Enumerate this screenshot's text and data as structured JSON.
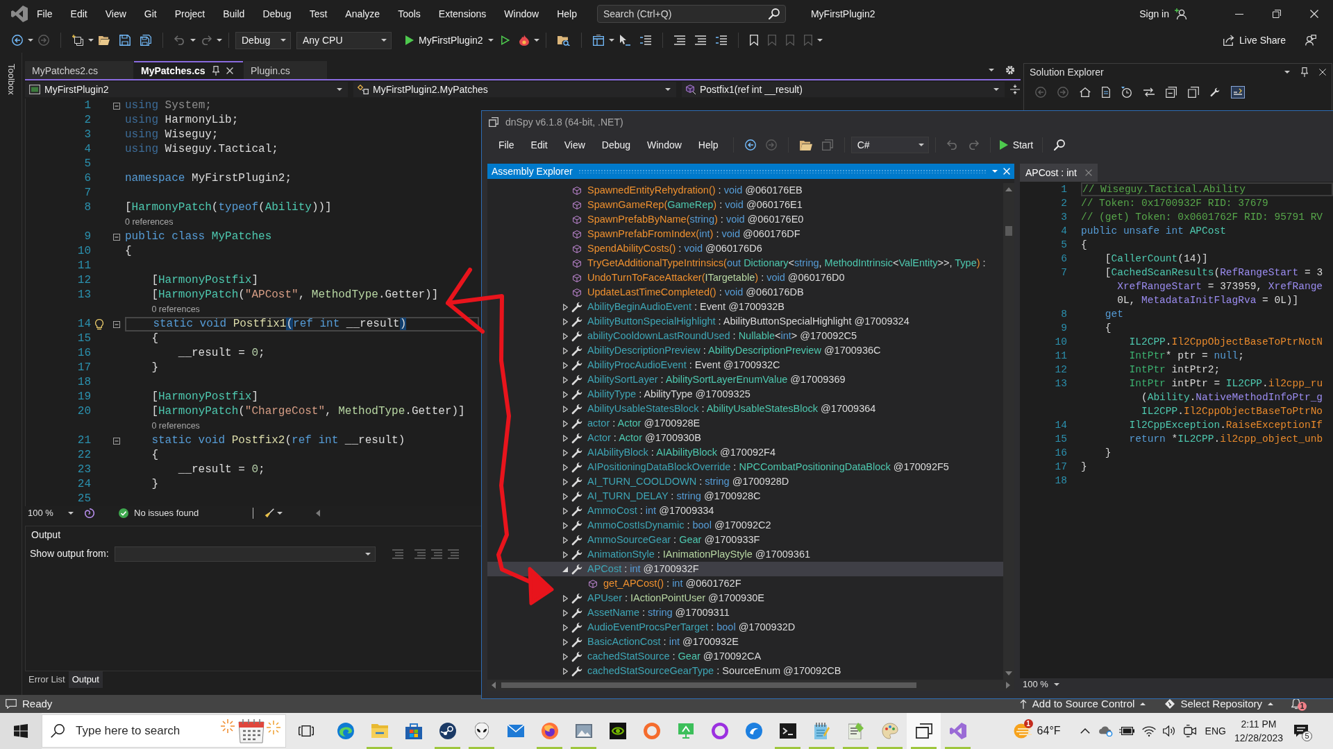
{
  "window": {
    "title": "MyFirstPlugin2",
    "search": {
      "placeholder": "Search (Ctrl+Q)"
    },
    "sign_in": "Sign in"
  },
  "menu": [
    "File",
    "Edit",
    "View",
    "Git",
    "Project",
    "Build",
    "Debug",
    "Test",
    "Analyze",
    "Tools",
    "Extensions",
    "Window",
    "Help"
  ],
  "toolbar": {
    "configuration": "Debug",
    "platform": "Any CPU",
    "start": "MyFirstPlugin2",
    "live_share": "Live Share"
  },
  "toolbox": "Toolbox",
  "tabs": [
    {
      "label": "MyPatches2.cs",
      "selected": false
    },
    {
      "label": "MyPatches.cs",
      "selected": true
    },
    {
      "label": "Plugin.cs",
      "selected": false
    }
  ],
  "navigation": [
    "MyFirstPlugin2",
    "MyFirstPlugin2.MyPatches",
    "Postfix1(ref int __result)"
  ],
  "editor": {
    "zoom": "100 %",
    "issues": "No issues found",
    "lines": [
      {
        "number": "1",
        "current": false,
        "expanded": true,
        "tokens": [
          {
            "text": "using",
            "kind": "dimkw"
          },
          {
            "text": " System;",
            "kind": "dim"
          }
        ]
      },
      {
        "number": "2",
        "current": false,
        "tokens": [
          {
            "text": "using",
            "kind": "dimkw"
          },
          {
            "text": " HarmonyLib;",
            "kind": "plain"
          }
        ]
      },
      {
        "number": "3",
        "current": false,
        "tokens": [
          {
            "text": "using",
            "kind": "dimkw"
          },
          {
            "text": " Wiseguy;",
            "kind": "plain"
          }
        ]
      },
      {
        "number": "4",
        "current": false,
        "tokens": [
          {
            "text": "using",
            "kind": "dimkw"
          },
          {
            "text": " Wiseguy.Tactical;",
            "kind": "plain"
          }
        ]
      },
      {
        "number": "5",
        "current": false
      },
      {
        "number": "6",
        "current": false,
        "tokens": [
          {
            "text": "namespace",
            "kind": "kw"
          },
          {
            "text": " MyFirstPlugin2;",
            "kind": "plain"
          }
        ]
      },
      {
        "number": "7",
        "current": false
      },
      {
        "number": "8",
        "current": false,
        "tokens": [
          {
            "text": "[",
            "kind": "plain"
          },
          {
            "text": "HarmonyPatch",
            "kind": "type"
          },
          {
            "text": "(",
            "kind": "plain"
          },
          {
            "text": "typeof",
            "kind": "kw"
          },
          {
            "text": "(",
            "kind": "plain"
          },
          {
            "text": "Ability",
            "kind": "type"
          },
          {
            "text": "))]",
            "kind": "plain"
          }
        ]
      },
      {
        "number": "9",
        "current": false,
        "expanded": true,
        "lens": "0 references",
        "tokens": [
          {
            "text": "public class ",
            "kind": "kw"
          },
          {
            "text": "MyPatches",
            "kind": "type"
          }
        ]
      },
      {
        "number": "10",
        "current": false,
        "tokens": [
          {
            "text": "{",
            "kind": "plain"
          }
        ]
      },
      {
        "number": "11",
        "current": false
      },
      {
        "number": "12",
        "current": false,
        "tokens": [
          {
            "text": "    [",
            "kind": "plain"
          },
          {
            "text": "HarmonyPostfix",
            "kind": "type"
          },
          {
            "text": "]",
            "kind": "plain"
          }
        ]
      },
      {
        "number": "13",
        "current": false,
        "tokens": [
          {
            "text": "    [",
            "kind": "plain"
          },
          {
            "text": "HarmonyPatch",
            "kind": "type"
          },
          {
            "text": "(",
            "kind": "plain"
          },
          {
            "text": "\"APCost\"",
            "kind": "string"
          },
          {
            "text": ", ",
            "kind": "plain"
          },
          {
            "text": "MethodType",
            "kind": "enum"
          },
          {
            "text": ".Getter)]",
            "kind": "plain"
          }
        ]
      },
      {
        "number": "14",
        "current": true,
        "expanded": true,
        "lens": "0 references",
        "tokens": [
          {
            "text": "    static void ",
            "kind": "kw"
          },
          {
            "text": "Postfix1",
            "kind": "method"
          },
          {
            "text": "(",
            "kind": "match"
          },
          {
            "text": "ref int",
            "kind": "kw"
          },
          {
            "text": " __result",
            "kind": "plain"
          },
          {
            "text": ")",
            "kind": "match"
          }
        ]
      },
      {
        "number": "15",
        "current": false,
        "tokens": [
          {
            "text": "    {",
            "kind": "plain"
          }
        ]
      },
      {
        "number": "16",
        "current": false,
        "tokens": [
          {
            "text": "        __result = ",
            "kind": "plain"
          },
          {
            "text": "0",
            "kind": "num"
          },
          {
            "text": ";",
            "kind": "plain"
          }
        ]
      },
      {
        "number": "17",
        "current": false,
        "tokens": [
          {
            "text": "    }",
            "kind": "plain"
          }
        ]
      },
      {
        "number": "18",
        "current": false
      },
      {
        "number": "19",
        "current": false,
        "tokens": [
          {
            "text": "    [",
            "kind": "plain"
          },
          {
            "text": "HarmonyPostfix",
            "kind": "type"
          },
          {
            "text": "]",
            "kind": "plain"
          }
        ]
      },
      {
        "number": "20",
        "current": false,
        "tokens": [
          {
            "text": "    [",
            "kind": "plain"
          },
          {
            "text": "HarmonyPatch",
            "kind": "type"
          },
          {
            "text": "(",
            "kind": "plain"
          },
          {
            "text": "\"ChargeCost\"",
            "kind": "string"
          },
          {
            "text": ", ",
            "kind": "plain"
          },
          {
            "text": "MethodType",
            "kind": "enum"
          },
          {
            "text": ".Getter)]",
            "kind": "plain"
          }
        ]
      },
      {
        "number": "21",
        "current": false,
        "expanded": true,
        "lens": "0 references",
        "tokens": [
          {
            "text": "    static void ",
            "kind": "kw"
          },
          {
            "text": "Postfix2",
            "kind": "method"
          },
          {
            "text": "(",
            "kind": "plain"
          },
          {
            "text": "ref int",
            "kind": "kw"
          },
          {
            "text": " __result)",
            "kind": "plain"
          }
        ]
      },
      {
        "number": "22",
        "current": false,
        "tokens": [
          {
            "text": "    {",
            "kind": "plain"
          }
        ]
      },
      {
        "number": "23",
        "current": false,
        "tokens": [
          {
            "text": "        __result = ",
            "kind": "plain"
          },
          {
            "text": "0",
            "kind": "num"
          },
          {
            "text": ";",
            "kind": "plain"
          }
        ]
      },
      {
        "number": "24",
        "current": false,
        "tokens": [
          {
            "text": "    }",
            "kind": "plain"
          }
        ]
      },
      {
        "number": "25",
        "current": false
      }
    ]
  },
  "output": {
    "title": "Output",
    "source_label": "Show output from:"
  },
  "panel_tabs": [
    {
      "label": "Error List",
      "selected": false
    },
    {
      "label": "Output",
      "selected": true
    }
  ],
  "solution_explorer": {
    "title": "Solution Explorer"
  },
  "status_bar": {
    "text": "Ready",
    "source_control": "Add to Source Control",
    "repository": "Select Repository",
    "notifications": "1"
  },
  "dnspy": {
    "title": "dnSpy v6.1.8 (64-bit, .NET)",
    "menu": [
      "File",
      "Edit",
      "View",
      "Debug",
      "Window",
      "Help"
    ],
    "language": "C#",
    "start": "Start",
    "explorer": {
      "title": "Assembly Explorer",
      "rows": [
        {
          "kind": "method",
          "selected": false,
          "parts": [
            {
              "text": "SpawnedEntityRehydration()",
              "kind": "method"
            },
            {
              "text": " : ",
              "kind": "plain"
            },
            {
              "text": "void",
              "kind": "kw"
            },
            {
              "text": " @060176EB",
              "kind": "plain"
            }
          ]
        },
        {
          "kind": "method",
          "selected": false,
          "parts": [
            {
              "text": "SpawnGameRep(",
              "kind": "method"
            },
            {
              "text": "GameRep",
              "kind": "type"
            },
            {
              "text": ")",
              "kind": "method"
            },
            {
              "text": " : ",
              "kind": "plain"
            },
            {
              "text": "void",
              "kind": "kw"
            },
            {
              "text": " @060176E1",
              "kind": "plain"
            }
          ]
        },
        {
          "kind": "method",
          "selected": false,
          "parts": [
            {
              "text": "SpawnPrefabByName(",
              "kind": "method"
            },
            {
              "text": "string",
              "kind": "kw"
            },
            {
              "text": ")",
              "kind": "method"
            },
            {
              "text": " : ",
              "kind": "plain"
            },
            {
              "text": "void",
              "kind": "kw"
            },
            {
              "text": " @060176E0",
              "kind": "plain"
            }
          ]
        },
        {
          "kind": "method",
          "selected": false,
          "parts": [
            {
              "text": "SpawnPrefabFromIndex(",
              "kind": "method"
            },
            {
              "text": "int",
              "kind": "kw"
            },
            {
              "text": ")",
              "kind": "method"
            },
            {
              "text": " : ",
              "kind": "plain"
            },
            {
              "text": "void",
              "kind": "kw"
            },
            {
              "text": " @060176DF",
              "kind": "plain"
            }
          ]
        },
        {
          "kind": "method",
          "selected": false,
          "parts": [
            {
              "text": "SpendAbilityCosts()",
              "kind": "method"
            },
            {
              "text": " : ",
              "kind": "plain"
            },
            {
              "text": "void",
              "kind": "kw"
            },
            {
              "text": " @060176D6",
              "kind": "plain"
            }
          ]
        },
        {
          "kind": "method",
          "selected": false,
          "parts": [
            {
              "text": "TryGetAdditionalTypeIntrinsics(",
              "kind": "method"
            },
            {
              "text": "out ",
              "kind": "kw"
            },
            {
              "text": "Dictionary",
              "kind": "type"
            },
            {
              "text": "<",
              "kind": "plain"
            },
            {
              "text": "string",
              "kind": "kw"
            },
            {
              "text": ", ",
              "kind": "plain"
            },
            {
              "text": "MethodIntrinsic",
              "kind": "type"
            },
            {
              "text": "<",
              "kind": "plain"
            },
            {
              "text": "ValEntity",
              "kind": "type"
            },
            {
              "text": ">>, ",
              "kind": "plain"
            },
            {
              "text": "Type",
              "kind": "type"
            },
            {
              "text": ")",
              "kind": "method"
            },
            {
              "text": " :",
              "kind": "plain"
            }
          ]
        },
        {
          "kind": "method",
          "selected": false,
          "parts": [
            {
              "text": "UndoTurnToFaceAttacker(",
              "kind": "method"
            },
            {
              "text": "ITargetable",
              "kind": "iface"
            },
            {
              "text": ")",
              "kind": "method"
            },
            {
              "text": " : ",
              "kind": "plain"
            },
            {
              "text": "void",
              "kind": "kw"
            },
            {
              "text": " @060176D0",
              "kind": "plain"
            }
          ]
        },
        {
          "kind": "method",
          "selected": false,
          "parts": [
            {
              "text": "UpdateLastTimeCompleted()",
              "kind": "method"
            },
            {
              "text": " : ",
              "kind": "plain"
            },
            {
              "text": "void",
              "kind": "kw"
            },
            {
              "text": " @060176DB",
              "kind": "plain"
            }
          ]
        },
        {
          "kind": "property",
          "expanded": false,
          "selected": false,
          "parts": [
            {
              "text": "AbilityBeginAudioEvent",
              "kind": "prop"
            },
            {
              "text": " : Event @1700932B",
              "kind": "plain"
            }
          ]
        },
        {
          "kind": "property",
          "expanded": false,
          "selected": false,
          "parts": [
            {
              "text": "AbilityButtonSpecialHighlight",
              "kind": "prop"
            },
            {
              "text": " : AbilityButtonSpecialHighlight @17009324",
              "kind": "plain"
            }
          ]
        },
        {
          "kind": "property",
          "expanded": false,
          "selected": false,
          "parts": [
            {
              "text": "abilityCooldownLastRoundUsed",
              "kind": "prop"
            },
            {
              "text": " : ",
              "kind": "plain"
            },
            {
              "text": "Nullable",
              "kind": "type"
            },
            {
              "text": "<",
              "kind": "plain"
            },
            {
              "text": "int",
              "kind": "kw"
            },
            {
              "text": "> @170092C5",
              "kind": "plain"
            }
          ]
        },
        {
          "kind": "property",
          "expanded": false,
          "selected": false,
          "parts": [
            {
              "text": "AbilityDescriptionPreview",
              "kind": "prop"
            },
            {
              "text": " : ",
              "kind": "plain"
            },
            {
              "text": "AbilityDescriptionPreview",
              "kind": "type"
            },
            {
              "text": " @1700936C",
              "kind": "plain"
            }
          ]
        },
        {
          "kind": "property",
          "expanded": false,
          "selected": false,
          "parts": [
            {
              "text": "AbilityProcAudioEvent",
              "kind": "prop"
            },
            {
              "text": " : Event @1700932C",
              "kind": "plain"
            }
          ]
        },
        {
          "kind": "property",
          "expanded": false,
          "selected": false,
          "parts": [
            {
              "text": "AbilitySortLayer",
              "kind": "prop"
            },
            {
              "text": " : ",
              "kind": "plain"
            },
            {
              "text": "AbilitySortLayerEnumValue",
              "kind": "type"
            },
            {
              "text": " @17009369",
              "kind": "plain"
            }
          ]
        },
        {
          "kind": "property",
          "expanded": false,
          "selected": false,
          "parts": [
            {
              "text": "AbilityType",
              "kind": "prop"
            },
            {
              "text": " : AbilityType @17009325",
              "kind": "plain"
            }
          ]
        },
        {
          "kind": "property",
          "expanded": false,
          "selected": false,
          "parts": [
            {
              "text": "AbilityUsableStatesBlock",
              "kind": "prop"
            },
            {
              "text": " : ",
              "kind": "plain"
            },
            {
              "text": "AbilityUsableStatesBlock",
              "kind": "type"
            },
            {
              "text": " @17009364",
              "kind": "plain"
            }
          ]
        },
        {
          "kind": "property",
          "expanded": false,
          "selected": false,
          "parts": [
            {
              "text": "actor",
              "kind": "prop"
            },
            {
              "text": " : ",
              "kind": "plain"
            },
            {
              "text": "Actor",
              "kind": "type"
            },
            {
              "text": " @1700928E",
              "kind": "plain"
            }
          ]
        },
        {
          "kind": "property",
          "expanded": false,
          "selected": false,
          "parts": [
            {
              "text": "Actor",
              "kind": "prop"
            },
            {
              "text": " : ",
              "kind": "plain"
            },
            {
              "text": "Actor",
              "kind": "type"
            },
            {
              "text": " @1700930B",
              "kind": "plain"
            }
          ]
        },
        {
          "kind": "property",
          "expanded": false,
          "selected": false,
          "parts": [
            {
              "text": "AIAbilityBlock",
              "kind": "prop"
            },
            {
              "text": " : ",
              "kind": "plain"
            },
            {
              "text": "AIAbilityBlock",
              "kind": "type"
            },
            {
              "text": " @170092F4",
              "kind": "plain"
            }
          ]
        },
        {
          "kind": "property",
          "expanded": false,
          "selected": false,
          "parts": [
            {
              "text": "AIPositioningDataBlockOverride",
              "kind": "prop"
            },
            {
              "text": " : ",
              "kind": "plain"
            },
            {
              "text": "NPCCombatPositioningDataBlock",
              "kind": "type"
            },
            {
              "text": " @170092F5",
              "kind": "plain"
            }
          ]
        },
        {
          "kind": "property",
          "expanded": false,
          "selected": false,
          "parts": [
            {
              "text": "AI_TURN_COOLDOWN",
              "kind": "prop"
            },
            {
              "text": " : ",
              "kind": "plain"
            },
            {
              "text": "string",
              "kind": "kw"
            },
            {
              "text": " @1700928D",
              "kind": "plain"
            }
          ]
        },
        {
          "kind": "property",
          "expanded": false,
          "selected": false,
          "parts": [
            {
              "text": "AI_TURN_DELAY",
              "kind": "prop"
            },
            {
              "text": " : ",
              "kind": "plain"
            },
            {
              "text": "string",
              "kind": "kw"
            },
            {
              "text": " @1700928C",
              "kind": "plain"
            }
          ]
        },
        {
          "kind": "property",
          "expanded": false,
          "selected": false,
          "parts": [
            {
              "text": "AmmoCost",
              "kind": "prop"
            },
            {
              "text": " : ",
              "kind": "plain"
            },
            {
              "text": "int",
              "kind": "kw"
            },
            {
              "text": " @17009334",
              "kind": "plain"
            }
          ]
        },
        {
          "kind": "property",
          "expanded": false,
          "selected": false,
          "parts": [
            {
              "text": "AmmoCostIsDynamic",
              "kind": "prop"
            },
            {
              "text": " : ",
              "kind": "plain"
            },
            {
              "text": "bool",
              "kind": "kw"
            },
            {
              "text": " @170092C2",
              "kind": "plain"
            }
          ]
        },
        {
          "kind": "property",
          "expanded": false,
          "selected": false,
          "parts": [
            {
              "text": "AmmoSourceGear",
              "kind": "prop"
            },
            {
              "text": " : ",
              "kind": "plain"
            },
            {
              "text": "Gear",
              "kind": "type"
            },
            {
              "text": " @1700933F",
              "kind": "plain"
            }
          ]
        },
        {
          "kind": "property",
          "expanded": false,
          "selected": false,
          "parts": [
            {
              "text": "AnimationStyle",
              "kind": "prop"
            },
            {
              "text": " : ",
              "kind": "plain"
            },
            {
              "text": "IAnimationPlayStyle",
              "kind": "iface"
            },
            {
              "text": " @17009361",
              "kind": "plain"
            }
          ]
        },
        {
          "kind": "property",
          "expanded": true,
          "selected": true,
          "parts": [
            {
              "text": "APCost",
              "kind": "prop"
            },
            {
              "text": " : ",
              "kind": "plain"
            },
            {
              "text": "int",
              "kind": "kw"
            },
            {
              "text": " @1700932F",
              "kind": "plain"
            }
          ],
          "children": [
            {
              "kind": "method",
              "selected": false,
              "parts": [
                {
                  "text": "get_APCost()",
                  "kind": "method"
                },
                {
                  "text": " : ",
                  "kind": "plain"
                },
                {
                  "text": "int",
                  "kind": "kw"
                },
                {
                  "text": " @0601762F",
                  "kind": "plain"
                }
              ]
            }
          ]
        },
        {
          "kind": "property",
          "expanded": false,
          "selected": false,
          "parts": [
            {
              "text": "APUser",
              "kind": "prop"
            },
            {
              "text": " : ",
              "kind": "plain"
            },
            {
              "text": "IActionPointUser",
              "kind": "iface"
            },
            {
              "text": " @1700930E",
              "kind": "plain"
            }
          ]
        },
        {
          "kind": "property",
          "expanded": false,
          "selected": false,
          "parts": [
            {
              "text": "AssetName",
              "kind": "prop"
            },
            {
              "text": " : ",
              "kind": "plain"
            },
            {
              "text": "string",
              "kind": "kw"
            },
            {
              "text": " @17009311",
              "kind": "plain"
            }
          ]
        },
        {
          "kind": "property",
          "expanded": false,
          "selected": false,
          "parts": [
            {
              "text": "AudioEventProcsPerTarget",
              "kind": "prop"
            },
            {
              "text": " : ",
              "kind": "plain"
            },
            {
              "text": "bool",
              "kind": "kw"
            },
            {
              "text": " @1700932D",
              "kind": "plain"
            }
          ]
        },
        {
          "kind": "property",
          "expanded": false,
          "selected": false,
          "parts": [
            {
              "text": "BasicActionCost",
              "kind": "prop"
            },
            {
              "text": " : ",
              "kind": "plain"
            },
            {
              "text": "int",
              "kind": "kw"
            },
            {
              "text": " @1700932E",
              "kind": "plain"
            }
          ]
        },
        {
          "kind": "property",
          "expanded": false,
          "selected": false,
          "parts": [
            {
              "text": "cachedStatSource",
              "kind": "prop"
            },
            {
              "text": " : ",
              "kind": "plain"
            },
            {
              "text": "Gear",
              "kind": "type"
            },
            {
              "text": " @170092CA",
              "kind": "plain"
            }
          ]
        },
        {
          "kind": "property",
          "expanded": false,
          "selected": false,
          "parts": [
            {
              "text": "cachedStatSourceGearType",
              "kind": "prop"
            },
            {
              "text": " : SourceEnum @170092CB",
              "kind": "plain"
            }
          ]
        }
      ]
    },
    "document": {
      "tab": "APCost : int",
      "zoom": "100 %",
      "lines": [
        {
          "number": "1",
          "current": true,
          "tokens": [
            {
              "text": "// Wiseguy.Tactical.Ability",
              "kind": "comment"
            }
          ]
        },
        {
          "number": "2",
          "current": false,
          "tokens": [
            {
              "text": "// Token: 0x1700932F RID: 37679",
              "kind": "comment"
            }
          ]
        },
        {
          "number": "3",
          "current": false,
          "tokens": [
            {
              "text": "// (get) Token: 0x0601762F RID: 95791 RV",
              "kind": "comment"
            }
          ]
        },
        {
          "number": "4",
          "current": false,
          "tokens": [
            {
              "text": "public unsafe int ",
              "kind": "kw"
            },
            {
              "text": "APCost",
              "kind": "type"
            }
          ]
        },
        {
          "number": "5",
          "current": false,
          "tokens": [
            {
              "text": "{",
              "kind": "plain"
            }
          ]
        },
        {
          "number": "6",
          "current": false,
          "tokens": [
            {
              "text": "    [",
              "kind": "plain"
            },
            {
              "text": "CallerCount",
              "kind": "type"
            },
            {
              "text": "(14)]",
              "kind": "plain"
            }
          ]
        },
        {
          "number": "7",
          "current": false,
          "tokens": [
            {
              "text": "    [",
              "kind": "plain"
            },
            {
              "text": "CachedScanResults",
              "kind": "type"
            },
            {
              "text": "(",
              "kind": "plain"
            },
            {
              "text": "RefRangeStart",
              "kind": "field"
            },
            {
              "text": " = 3",
              "kind": "plain"
            }
          ]
        },
        {
          "current": false,
          "tokens": [
            {
              "text": "      XrefRangeStart",
              "kind": "field"
            },
            {
              "text": " = 373959, ",
              "kind": "plain"
            },
            {
              "text": "XrefRange",
              "kind": "field"
            }
          ]
        },
        {
          "current": false,
          "tokens": [
            {
              "text": "      0L, ",
              "kind": "plain"
            },
            {
              "text": "MetadataInitFlagRva",
              "kind": "field"
            },
            {
              "text": " = 0L)]",
              "kind": "plain"
            }
          ]
        },
        {
          "number": "8",
          "current": false,
          "tokens": [
            {
              "text": "    get",
              "kind": "kw"
            }
          ]
        },
        {
          "number": "9",
          "current": false,
          "tokens": [
            {
              "text": "    {",
              "kind": "plain"
            }
          ]
        },
        {
          "number": "10",
          "current": false,
          "tokens": [
            {
              "text": "        IL2CPP",
              "kind": "type"
            },
            {
              "text": ".",
              "kind": "plain"
            },
            {
              "text": "Il2CppObjectBaseToPtrNotN",
              "kind": "smethod"
            }
          ]
        },
        {
          "number": "11",
          "current": false,
          "tokens": [
            {
              "text": "        IntPtr",
              "kind": "struct"
            },
            {
              "text": "* ptr = ",
              "kind": "plain"
            },
            {
              "text": "null",
              "kind": "kw"
            },
            {
              "text": ";",
              "kind": "plain"
            }
          ]
        },
        {
          "number": "12",
          "current": false,
          "tokens": [
            {
              "text": "        IntPtr",
              "kind": "struct"
            },
            {
              "text": " intPtr2;",
              "kind": "plain"
            }
          ]
        },
        {
          "number": "13",
          "current": false,
          "tokens": [
            {
              "text": "        IntPtr",
              "kind": "struct"
            },
            {
              "text": " intPtr = ",
              "kind": "plain"
            },
            {
              "text": "IL2CPP",
              "kind": "type"
            },
            {
              "text": ".",
              "kind": "plain"
            },
            {
              "text": "il2cpp_ru",
              "kind": "smethod"
            }
          ]
        },
        {
          "current": false,
          "tokens": [
            {
              "text": "          (",
              "kind": "plain"
            },
            {
              "text": "Ability",
              "kind": "type"
            },
            {
              "text": ".",
              "kind": "plain"
            },
            {
              "text": "NativeMethodInfoPtr_g",
              "kind": "field"
            }
          ]
        },
        {
          "current": false,
          "tokens": [
            {
              "text": "          IL2CPP",
              "kind": "type"
            },
            {
              "text": ".",
              "kind": "plain"
            },
            {
              "text": "Il2CppObjectBaseToPtrNo",
              "kind": "smethod"
            }
          ]
        },
        {
          "number": "14",
          "current": false,
          "tokens": [
            {
              "text": "        Il2CppException",
              "kind": "type"
            },
            {
              "text": ".",
              "kind": "plain"
            },
            {
              "text": "RaiseExceptionIf",
              "kind": "smethod"
            }
          ]
        },
        {
          "number": "15",
          "current": false,
          "tokens": [
            {
              "text": "        return",
              "kind": "kw"
            },
            {
              "text": " *",
              "kind": "plain"
            },
            {
              "text": "IL2CPP",
              "kind": "type"
            },
            {
              "text": ".",
              "kind": "plain"
            },
            {
              "text": "il2cpp_object_unb",
              "kind": "smethod"
            }
          ]
        },
        {
          "number": "16",
          "current": false,
          "tokens": [
            {
              "text": "    }",
              "kind": "plain"
            }
          ]
        },
        {
          "number": "17",
          "current": false,
          "tokens": [
            {
              "text": "}",
              "kind": "plain"
            }
          ]
        },
        {
          "number": "18",
          "current": false
        }
      ]
    }
  },
  "taskbar": {
    "search": {
      "placeholder": "Type here to search"
    },
    "apps": [
      {
        "kind": "swirl",
        "running": false,
        "selected": false
      },
      {
        "kind": "folder",
        "running": true,
        "selected": false
      },
      {
        "kind": "bag",
        "running": false,
        "selected": false
      },
      {
        "kind": "disc",
        "running": true,
        "selected": false
      },
      {
        "kind": "alien",
        "running": true,
        "selected": false
      },
      {
        "kind": "envelope",
        "running": false,
        "selected": false
      },
      {
        "kind": "globe",
        "running": true,
        "selected": false
      },
      {
        "kind": "picture",
        "running": true,
        "selected": false
      },
      {
        "kind": "eyetile",
        "running": false,
        "selected": false
      },
      {
        "kind": "orangering",
        "running": false,
        "selected": false
      },
      {
        "kind": "monitor",
        "running": false,
        "selected": false
      },
      {
        "kind": "purplering",
        "running": false,
        "selected": false
      },
      {
        "kind": "bird",
        "running": false,
        "selected": false
      },
      {
        "kind": "terminal",
        "running": true,
        "selected": false
      },
      {
        "kind": "notepad",
        "running": true,
        "selected": false
      },
      {
        "kind": "chameleon",
        "running": true,
        "selected": false
      },
      {
        "kind": "palette",
        "running": true,
        "selected": false
      },
      {
        "kind": "windows",
        "running": true,
        "selected": true
      },
      {
        "kind": "ribbon",
        "running": true,
        "selected": false
      }
    ],
    "temperature": "64°F",
    "weather_badge": "1",
    "language": "ENG",
    "time": "2:11 PM",
    "date": "12/28/2023",
    "notifications": "5"
  }
}
